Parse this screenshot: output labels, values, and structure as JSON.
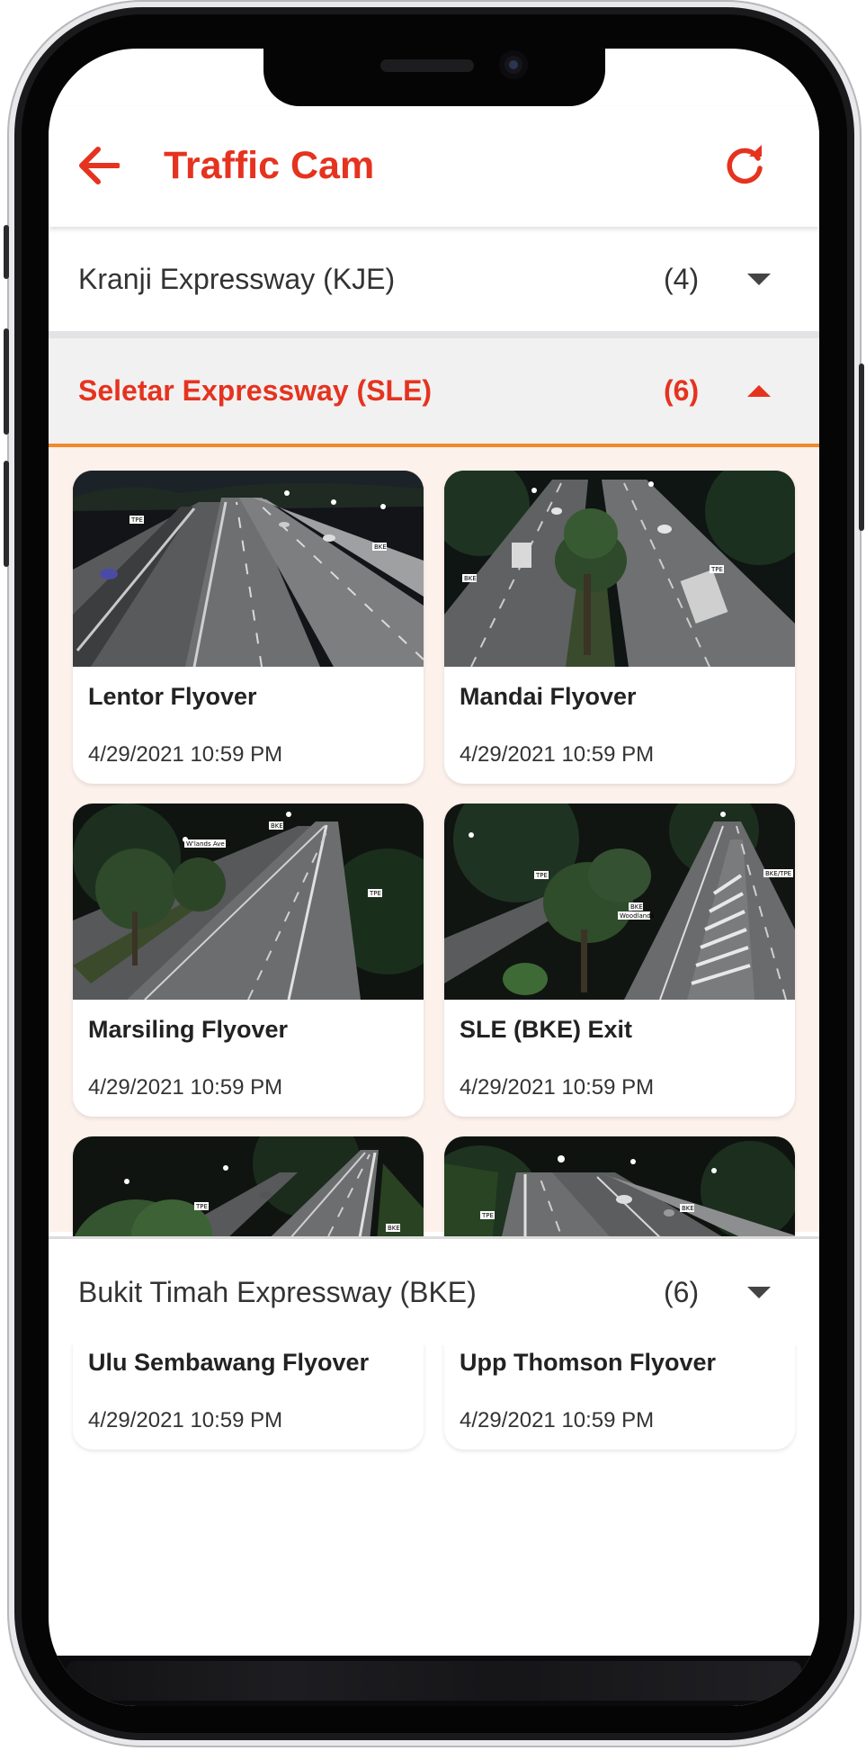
{
  "header": {
    "title": "Traffic Cam",
    "back_icon": "arrow-left-icon",
    "refresh_icon": "refresh-icon",
    "accent_color": "#e5331f"
  },
  "sections": [
    {
      "name": "Kranji Expressway (KJE)",
      "count": "(4)",
      "expanded": false
    },
    {
      "name": "Seletar Expressway (SLE)",
      "count": "(6)",
      "expanded": true
    },
    {
      "name": "Bukit Timah Expressway (BKE)",
      "count": "(6)",
      "expanded": false
    }
  ],
  "cameras": [
    {
      "name": "Lentor Flyover",
      "timestamp": "4/29/2021 10:59 PM"
    },
    {
      "name": "Mandai Flyover",
      "timestamp": "4/29/2021 10:59 PM"
    },
    {
      "name": "Marsiling Flyover",
      "timestamp": "4/29/2021 10:59 PM"
    },
    {
      "name": "SLE (BKE) Exit",
      "timestamp": "4/29/2021 10:59 PM"
    },
    {
      "name": "Ulu Sembawang Flyover",
      "timestamp": "4/29/2021 10:59 PM"
    },
    {
      "name": "Upp Thomson Flyover",
      "timestamp": "4/29/2021 10:59 PM"
    }
  ],
  "camera_image_labels": {
    "lentor": [
      "TPE",
      "BKE"
    ],
    "mandai": [
      "BKE",
      "TPE"
    ],
    "marsiling": [
      "W'lands Ave 2",
      "BKE",
      "TPE"
    ],
    "bke_exit": [
      "TPE",
      "BKE",
      "Woodlands",
      "BKE/TPE"
    ],
    "ulu_sembawang": [
      "TPE",
      "BKE"
    ],
    "upp_thomson": [
      "TPE",
      "BKE"
    ]
  }
}
